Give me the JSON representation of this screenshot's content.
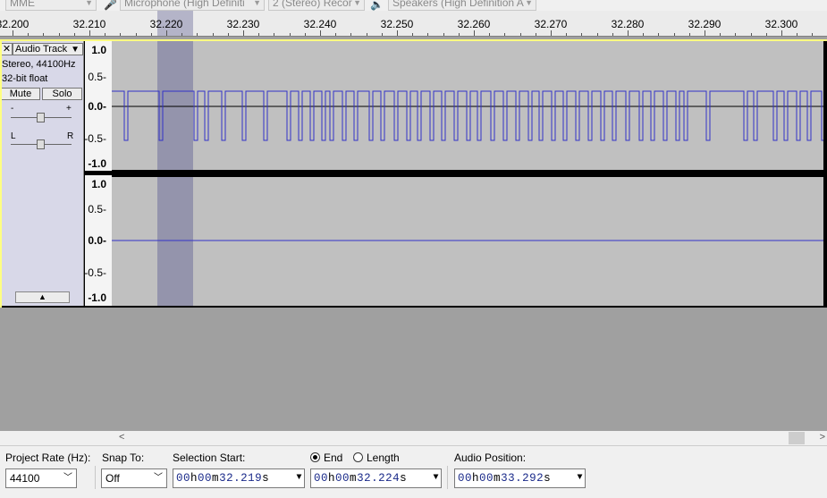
{
  "device_toolbar": {
    "host": "MME",
    "recording_device": "Microphone (High Definiti",
    "channels": "2 (Stereo) Recor",
    "playback_device": "Speakers (High Definition A"
  },
  "ruler": {
    "labels": [
      "32.200",
      "32.210",
      "32.220",
      "32.230",
      "32.240",
      "32.250",
      "32.260",
      "32.270",
      "32.280",
      "32.290",
      "32.300"
    ]
  },
  "track": {
    "close_label": "✕",
    "name": "Audio Track",
    "format": "Stereo, 44100Hz",
    "bit_depth": "32-bit float",
    "mute_label": "Mute",
    "solo_label": "Solo",
    "gain_minus": "-",
    "gain_plus": "+",
    "pan_left": "L",
    "pan_right": "R",
    "collapse_glyph": "▲"
  },
  "vruler": {
    "top": {
      "max": "1.0",
      "half": "0.5-",
      "zero": "0.0-",
      "neg_half": "-0.5-",
      "min": "-1.0"
    },
    "bottom": {
      "max": "1.0",
      "half": "0.5-",
      "zero": "0.0-",
      "neg_half": "-0.5-",
      "min": "-1.0"
    }
  },
  "selection_toolbar": {
    "project_rate_label": "Project Rate (Hz):",
    "project_rate_value": "44100",
    "snap_to_label": "Snap To:",
    "snap_to_value": "Off",
    "selection_start_label": "Selection Start:",
    "selection_start_value": {
      "h": "00",
      "m": "00",
      "s": "32.219"
    },
    "end_label": "End",
    "length_label": "Length",
    "end_value": {
      "h": "00",
      "m": "00",
      "s": "32.224"
    },
    "audio_position_label": "Audio Position:",
    "audio_position_value": {
      "h": "00",
      "m": "00",
      "s": "33.292"
    },
    "unit_h": "h",
    "unit_m": "m",
    "unit_s": "s"
  },
  "colors": {
    "waveform": "#3232c8",
    "selection": "#9494ac",
    "track_focus_border": "#ffff80",
    "panel_bg": "#c0c0c0"
  }
}
